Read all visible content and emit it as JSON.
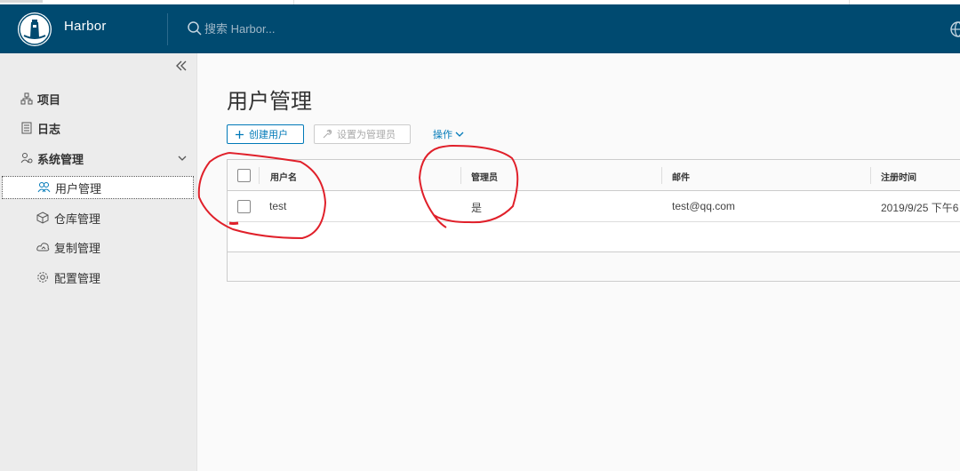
{
  "header": {
    "brand": "Harbor",
    "search_placeholder": "搜索 Harbor..."
  },
  "sidebar": {
    "items": [
      {
        "label": "项目",
        "icon": "projects-icon"
      },
      {
        "label": "日志",
        "icon": "logs-icon"
      },
      {
        "label": "系统管理",
        "icon": "admin-icon"
      }
    ],
    "subitems": [
      {
        "label": "用户管理",
        "icon": "users-icon",
        "active": true
      },
      {
        "label": "仓库管理",
        "icon": "registry-icon"
      },
      {
        "label": "复制管理",
        "icon": "replication-icon"
      },
      {
        "label": "配置管理",
        "icon": "config-icon"
      }
    ]
  },
  "main": {
    "title": "用户管理",
    "buttons": {
      "create": "创建用户",
      "set_admin": "设置为管理员",
      "actions": "操作"
    },
    "table": {
      "columns": [
        "用户名",
        "管理员",
        "邮件",
        "注册时间"
      ],
      "rows": [
        {
          "username": "test",
          "admin": "是",
          "email": "test@qq.com",
          "registered": "2019/9/25 下午6"
        }
      ]
    }
  },
  "colors": {
    "header_bg": "#004a70",
    "accent": "#0079b8",
    "annotation": "#e0202a"
  }
}
